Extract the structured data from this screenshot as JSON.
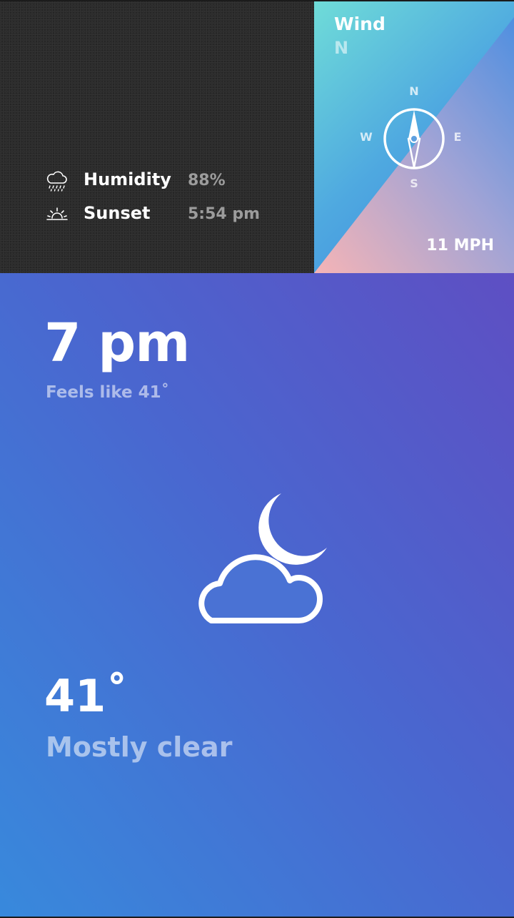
{
  "details": {
    "humidity": {
      "icon": "rain-cloud-icon",
      "label": "Humidity",
      "value": "88%"
    },
    "sunset": {
      "icon": "sunset-icon",
      "label": "Sunset",
      "value": "5:54 pm"
    }
  },
  "wind": {
    "title": "Wind",
    "direction": "N",
    "compass": {
      "north": "N",
      "south": "S",
      "west": "W",
      "east": "E",
      "icon": "compass-icon"
    },
    "speed": "11 MPH",
    "colors": {
      "top": "#6fdcd8",
      "middle": "#4f9fe0",
      "bottom": "#f3b3b7"
    }
  },
  "forecast": {
    "time": "7 pm",
    "feels_like": "Feels like 41˚",
    "icon": "cloud-moon-icon",
    "temperature": "41˚",
    "condition": "Mostly clear",
    "colors": {
      "gradient_start": "#3889dc",
      "gradient_end": "#5e4fc3"
    }
  }
}
